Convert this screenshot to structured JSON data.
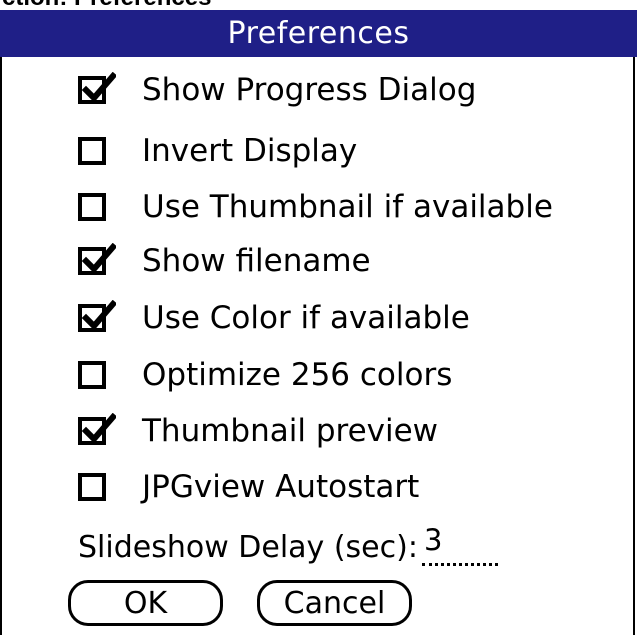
{
  "window": {
    "caption": "ction: Preferences"
  },
  "dialog": {
    "title": "Preferences"
  },
  "options": [
    {
      "label": "Show Progress Dialog",
      "checked": true
    },
    {
      "label": "Invert Display",
      "checked": false
    },
    {
      "label": "Use Thumbnail if available",
      "checked": false
    },
    {
      "label": "Show filename",
      "checked": true
    },
    {
      "label": "Use Color if available",
      "checked": true
    },
    {
      "label": "Optimize 256 colors",
      "checked": false
    },
    {
      "label": "Thumbnail preview",
      "checked": true
    },
    {
      "label": "JPGview Autostart",
      "checked": false
    }
  ],
  "slideshow": {
    "label": "Slideshow Delay (sec):",
    "value": "3"
  },
  "buttons": {
    "ok": "OK",
    "cancel": "Cancel"
  },
  "colors": {
    "title_bar": "#1f1f87",
    "title_text": "#ffffff",
    "background": "#ffffff",
    "foreground": "#000000"
  }
}
